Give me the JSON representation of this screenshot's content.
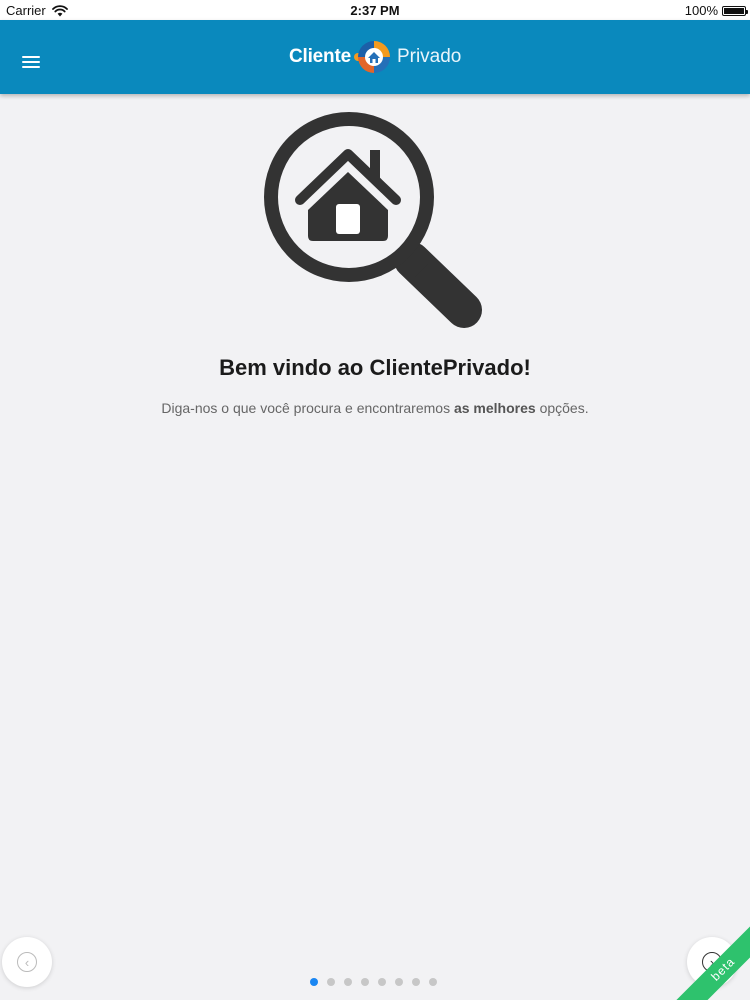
{
  "status_bar": {
    "carrier": "Carrier",
    "time": "2:37 PM",
    "battery": "100%",
    "battery_level": 1.0
  },
  "app_bar": {
    "logo": {
      "word1": "Cliente",
      "word2": "Privado"
    },
    "menu_icon": "hamburger-menu-icon"
  },
  "main": {
    "illustration_icon": "house-magnifier-icon",
    "title": "Bem vindo ao ClientePrivado!",
    "subtitle_before": "Diga-nos o que você procura e encontraremos ",
    "subtitle_bold": "as melhores",
    "subtitle_after": " opções."
  },
  "pager": {
    "total_pages": 8,
    "current_page": 1,
    "prev_icon": "chevron-left-icon",
    "next_icon": "chevron-right-icon"
  },
  "badge": {
    "text": "beta"
  },
  "colors": {
    "header": "#0a89bd",
    "background": "#f2f2f4",
    "active_dot": "#1a86f2",
    "inactive_dot": "#c7c7c7",
    "beta_ribbon": "#2ec26d",
    "icon_dark": "#333333",
    "logo_orange": "#f39a1e",
    "logo_blue": "#2470b8"
  }
}
